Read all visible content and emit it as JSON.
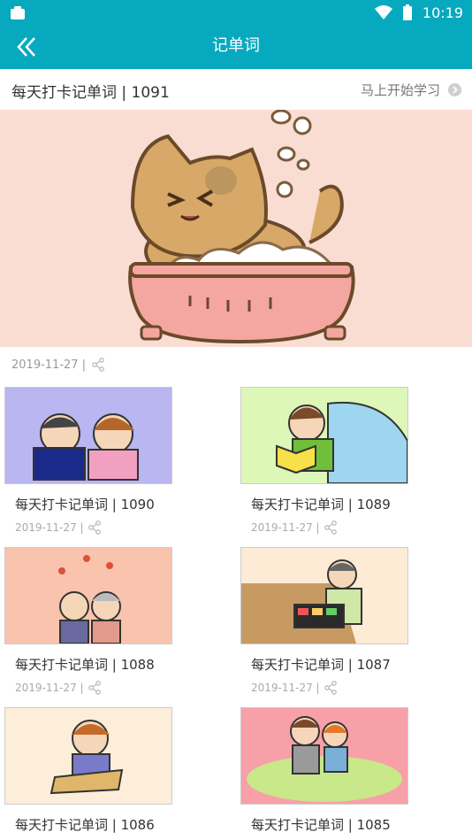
{
  "status": {
    "time": "10:19"
  },
  "appbar": {
    "title": "记单词"
  },
  "featured": {
    "title": "每天打卡记单词 | 1091",
    "start_label": "马上开始学习",
    "date": "2019-11-27 |"
  },
  "cards": [
    {
      "title": "每天打卡记单词 | 1090",
      "date": "2019-11-27 |"
    },
    {
      "title": "每天打卡记单词 | 1089",
      "date": "2019-11-27 |"
    },
    {
      "title": "每天打卡记单词 | 1088",
      "date": "2019-11-27 |"
    },
    {
      "title": "每天打卡记单词 | 1087",
      "date": "2019-11-27 |"
    },
    {
      "title": "每天打卡记单词 | 1086",
      "date": ""
    },
    {
      "title": "每天打卡记单词 | 1085",
      "date": ""
    }
  ],
  "colors": {
    "accent": "#07a9bf",
    "featured_bg": "#f9ddd2"
  },
  "icons": [
    "back-double-chevron-icon",
    "wifi-icon",
    "battery-icon",
    "share-icon",
    "chevron-right-icon"
  ]
}
